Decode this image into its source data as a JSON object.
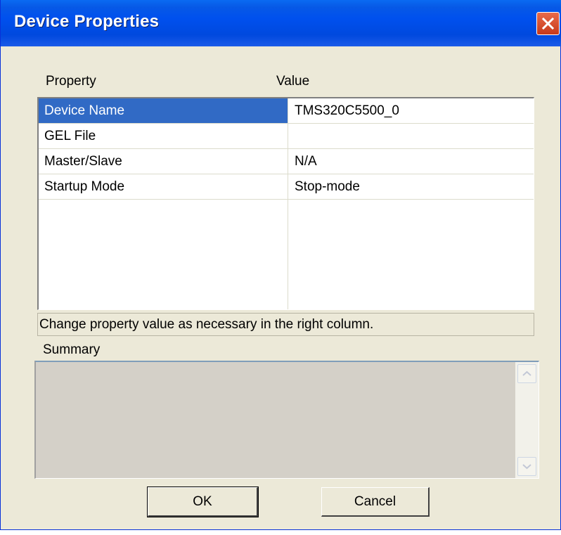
{
  "window": {
    "title": "Device Properties"
  },
  "grid": {
    "headers": {
      "property": "Property",
      "value": "Value"
    },
    "rows": [
      {
        "property": "Device Name",
        "value": "TMS320C5500_0",
        "selected": true
      },
      {
        "property": "GEL File",
        "value": ""
      },
      {
        "property": "Master/Slave",
        "value": "N/A"
      },
      {
        "property": "Startup Mode",
        "value": "Stop-mode"
      }
    ]
  },
  "status": {
    "text": "Change property value as necessary in the right column."
  },
  "summary": {
    "label": "Summary",
    "text": ""
  },
  "buttons": {
    "ok": "OK",
    "cancel": "Cancel"
  },
  "icons": {
    "close": "close-icon",
    "scroll_up": "arrow-up-icon",
    "scroll_down": "arrow-down-icon"
  },
  "colors": {
    "titlebar": "#0050ee",
    "selection": "#316ac5",
    "dialog_bg": "#ece9d8",
    "close_button": "#d44b26"
  }
}
